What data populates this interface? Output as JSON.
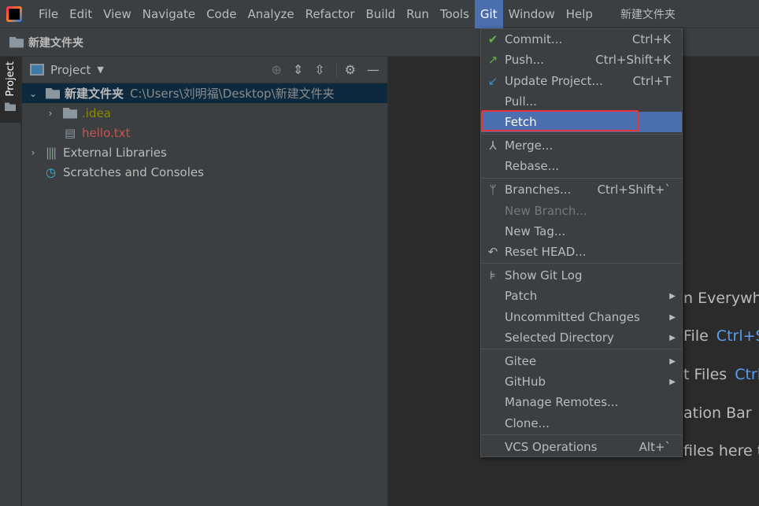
{
  "menubar": {
    "items": [
      "File",
      "Edit",
      "View",
      "Navigate",
      "Code",
      "Analyze",
      "Refactor",
      "Build",
      "Run",
      "Tools",
      "Git",
      "Window",
      "Help"
    ],
    "active": "Git",
    "title": "新建文件夹"
  },
  "navbar": {
    "project": "新建文件夹"
  },
  "stripe": {
    "tab": "Project"
  },
  "panel": {
    "title": "Project",
    "tree": [
      {
        "label": "新建文件夹",
        "path": "C:\\Users\\刘明福\\Desktop\\新建文件夹"
      },
      {
        "label": ".idea",
        "color": "#8a8a00"
      },
      {
        "label": "hello.txt",
        "color": "#c75450"
      },
      {
        "label": "External Libraries"
      },
      {
        "label": "Scratches and Consoles"
      }
    ]
  },
  "git_menu": {
    "items": [
      {
        "label": "Commit...",
        "shortcut": "Ctrl+K",
        "icon": "check-icon"
      },
      {
        "label": "Push...",
        "shortcut": "Ctrl+Shift+K",
        "icon": "push-arrow-icon"
      },
      {
        "label": "Update Project...",
        "shortcut": "Ctrl+T",
        "icon": "update-arrow-icon"
      },
      {
        "label": "Pull..."
      },
      {
        "label": "Fetch",
        "highlighted": true
      },
      {
        "label": "Merge...",
        "icon": "merge-icon"
      },
      {
        "label": "Rebase..."
      },
      {
        "label": "Branches...",
        "shortcut": "Ctrl+Shift+`",
        "icon": "branch-icon"
      },
      {
        "label": "New Branch...",
        "disabled": true
      },
      {
        "label": "New Tag..."
      },
      {
        "label": "Reset HEAD...",
        "icon": "undo-icon"
      },
      {
        "label": "Show Git Log",
        "icon": "git-log-icon"
      },
      {
        "label": "Patch",
        "submenu": true
      },
      {
        "label": "Uncommitted Changes",
        "submenu": true
      },
      {
        "label": "Selected Directory",
        "submenu": true
      },
      {
        "label": "Gitee",
        "submenu": true
      },
      {
        "label": "GitHub",
        "submenu": true
      },
      {
        "label": "Manage Remotes..."
      },
      {
        "label": "Clone..."
      },
      {
        "label": "VCS Operations",
        "shortcut": "Alt+`"
      }
    ]
  },
  "editor_hints": [
    {
      "text": "n Everywhe"
    },
    {
      "text": "File",
      "key": "Ctrl+S"
    },
    {
      "text": "t Files",
      "key": "Ctrl"
    },
    {
      "text": "ation Bar"
    },
    {
      "text": "files here t"
    }
  ]
}
